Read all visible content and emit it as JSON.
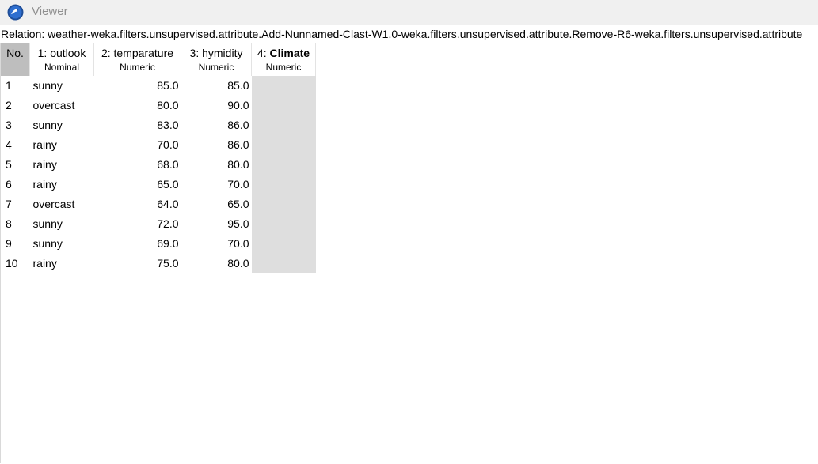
{
  "window": {
    "title": "Viewer",
    "icon": "weka-bird-icon"
  },
  "relation": {
    "text": "Relation: weather-weka.filters.unsupervised.attribute.Add-Nunnamed-Clast-W1.0-weka.filters.unsupervised.attribute.Remove-R6-weka.filters.unsupervised.attribute"
  },
  "table": {
    "columns": [
      {
        "index_label": "No.",
        "name": "",
        "type": ""
      },
      {
        "index_label": "1: ",
        "name": "outlook",
        "type": "Nominal"
      },
      {
        "index_label": "2: ",
        "name": "temparature",
        "type": "Numeric"
      },
      {
        "index_label": "3: ",
        "name": "hymidity",
        "type": "Numeric"
      },
      {
        "index_label": "4: ",
        "name": "Climate",
        "type": "Numeric"
      }
    ],
    "rows": [
      {
        "no": "1",
        "outlook": "sunny",
        "temparature": "85.0",
        "hymidity": "85.0",
        "climate": ""
      },
      {
        "no": "2",
        "outlook": "overcast",
        "temparature": "80.0",
        "hymidity": "90.0",
        "climate": ""
      },
      {
        "no": "3",
        "outlook": "sunny",
        "temparature": "83.0",
        "hymidity": "86.0",
        "climate": ""
      },
      {
        "no": "4",
        "outlook": "rainy",
        "temparature": "70.0",
        "hymidity": "86.0",
        "climate": ""
      },
      {
        "no": "5",
        "outlook": "rainy",
        "temparature": "68.0",
        "hymidity": "80.0",
        "climate": ""
      },
      {
        "no": "6",
        "outlook": "rainy",
        "temparature": "65.0",
        "hymidity": "70.0",
        "climate": ""
      },
      {
        "no": "7",
        "outlook": "overcast",
        "temparature": "64.0",
        "hymidity": "65.0",
        "climate": ""
      },
      {
        "no": "8",
        "outlook": "sunny",
        "temparature": "72.0",
        "hymidity": "95.0",
        "climate": ""
      },
      {
        "no": "9",
        "outlook": "sunny",
        "temparature": "69.0",
        "hymidity": "70.0",
        "climate": ""
      },
      {
        "no": "10",
        "outlook": "rainy",
        "temparature": "75.0",
        "hymidity": "80.0",
        "climate": ""
      }
    ]
  },
  "colors": {
    "titlebar_bg": "#f0f0f0",
    "no_header_bg": "#bebebe",
    "missing_cell_bg": "#dedede"
  }
}
